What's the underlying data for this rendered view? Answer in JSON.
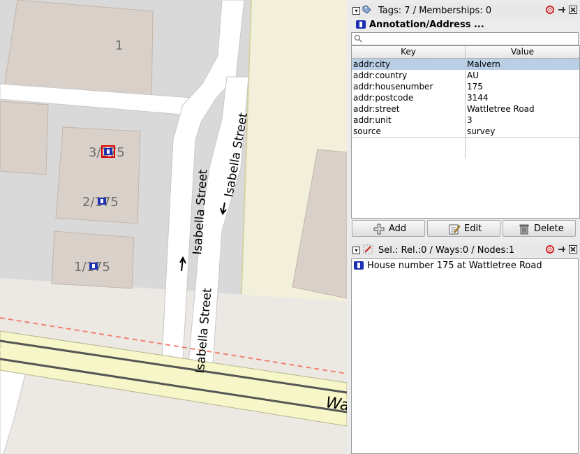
{
  "map": {
    "building_labels": [
      "1",
      "3/175",
      "2/175",
      "1/175"
    ],
    "street_labels": [
      "Isabella Street",
      "Isabella Street",
      "Isabella Street"
    ],
    "road_label": "Wa"
  },
  "tags_panel": {
    "title": "Tags: 7 / Memberships: 0",
    "preset_name": "Annotation/Address ...",
    "search_placeholder": "",
    "columns": [
      "Key",
      "Value"
    ],
    "rows": [
      {
        "key": "addr:city",
        "value": "Malvern"
      },
      {
        "key": "addr:country",
        "value": "AU"
      },
      {
        "key": "addr:housenumber",
        "value": "175"
      },
      {
        "key": "addr:postcode",
        "value": "3144"
      },
      {
        "key": "addr:street",
        "value": "Wattletree Road"
      },
      {
        "key": "addr:unit",
        "value": "3"
      },
      {
        "key": "source",
        "value": "survey"
      }
    ],
    "selected_row": 0,
    "buttons": {
      "add": "Add",
      "edit": "Edit",
      "delete": "Delete"
    }
  },
  "selection_panel": {
    "title": "Sel.: Rel.:0 / Ways:0 / Nodes:1",
    "items": [
      "House number 175 at Wattletree Road"
    ]
  },
  "colors": {
    "selection": "#b9cfe6",
    "map_background": "#d9d9d9",
    "building": "#d9d0c9",
    "node_icon": "#1c2fb5",
    "selected_node_outline": "#e00000"
  }
}
